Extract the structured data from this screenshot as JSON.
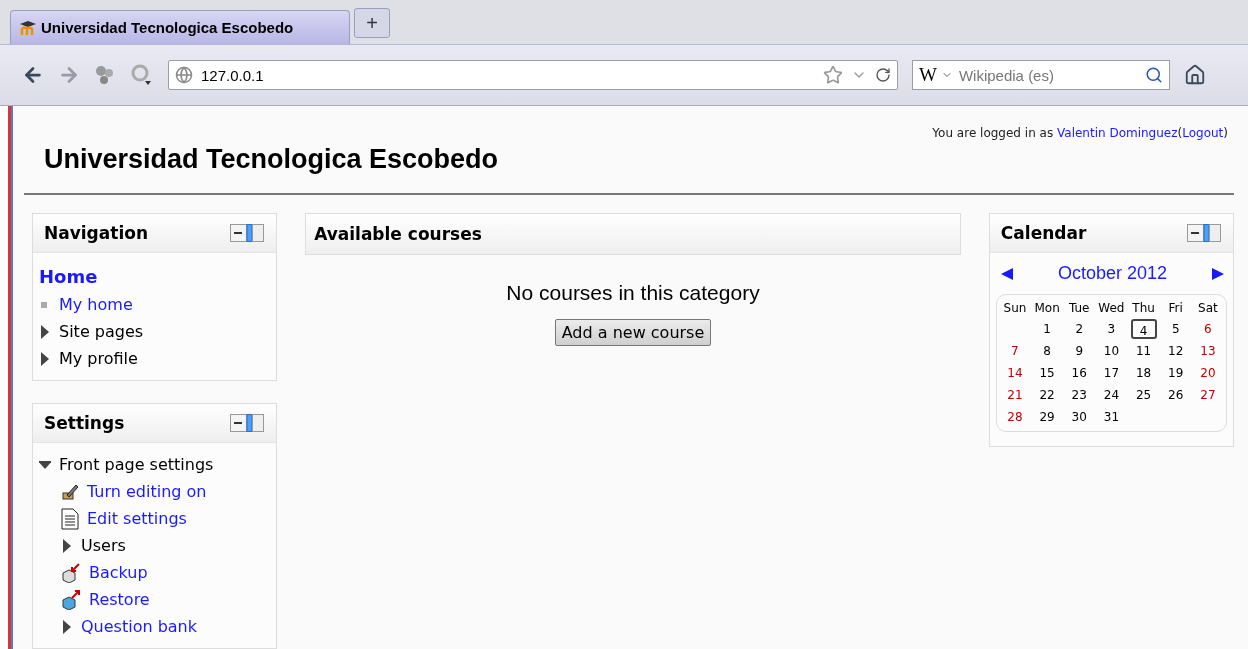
{
  "browser": {
    "tab": {
      "title": "Universidad Tecnologica Escobedo",
      "selected": true
    },
    "new_tab": "+",
    "address": "127.0.0.1",
    "search": {
      "engine": "W",
      "placeholder": "Wikipedia (es)"
    }
  },
  "header": {
    "site_title": "Universidad Tecnologica Escobedo",
    "login_prefix": "You are logged in as",
    "user": "Valentin Dominguez",
    "logout_open": "(",
    "logout": "Logout",
    "logout_close": ")"
  },
  "navigation": {
    "title": "Navigation",
    "home": "Home",
    "items": [
      {
        "label": "My home",
        "kind": "leaf",
        "link": true
      },
      {
        "label": "Site pages",
        "kind": "branch",
        "link": false,
        "expanded": false
      },
      {
        "label": "My profile",
        "kind": "branch",
        "link": false,
        "expanded": false
      }
    ]
  },
  "settings": {
    "title": "Settings",
    "items": [
      {
        "label": "Front page settings",
        "kind": "branch",
        "link": false,
        "expanded": true,
        "children": [
          {
            "label": "Turn editing on",
            "kind": "edit",
            "link": true
          },
          {
            "label": "Edit settings",
            "kind": "document",
            "link": true
          },
          {
            "label": "Users",
            "kind": "branch",
            "link": false,
            "expanded": false
          },
          {
            "label": "Backup",
            "kind": "backup",
            "link": true
          },
          {
            "label": "Restore",
            "kind": "restore",
            "link": true
          },
          {
            "label": "Question bank",
            "kind": "branch",
            "link": true,
            "expanded": false
          }
        ]
      }
    ]
  },
  "main": {
    "title": "Available courses",
    "message": "No courses in this category",
    "button": "Add a new course"
  },
  "calendar": {
    "title": "Calendar",
    "month": "October 2012",
    "weekdays": [
      "Sun",
      "Mon",
      "Tue",
      "Wed",
      "Thu",
      "Fri",
      "Sat"
    ],
    "weeks": [
      [
        {
          "day": "1",
          "weekend": false,
          "today": false
        },
        {
          "day": "2",
          "weekend": false,
          "today": false
        },
        {
          "day": "3",
          "weekend": false,
          "today": false
        },
        {
          "day": "4",
          "weekend": false,
          "today": true
        },
        {
          "day": "5",
          "weekend": false,
          "today": false
        },
        {
          "day": "6",
          "weekend": true,
          "today": false
        }
      ],
      [
        {
          "day": "7",
          "weekend": true,
          "today": false
        },
        {
          "day": "8",
          "weekend": false,
          "today": false
        },
        {
          "day": "9",
          "weekend": false,
          "today": false
        },
        {
          "day": "10",
          "weekend": false,
          "today": false
        },
        {
          "day": "11",
          "weekend": false,
          "today": false
        },
        {
          "day": "12",
          "weekend": false,
          "today": false
        },
        {
          "day": "13",
          "weekend": true,
          "today": false
        }
      ],
      [
        {
          "day": "14",
          "weekend": true,
          "today": false
        },
        {
          "day": "15",
          "weekend": false,
          "today": false
        },
        {
          "day": "16",
          "weekend": false,
          "today": false
        },
        {
          "day": "17",
          "weekend": false,
          "today": false
        },
        {
          "day": "18",
          "weekend": false,
          "today": false
        },
        {
          "day": "19",
          "weekend": false,
          "today": false
        },
        {
          "day": "20",
          "weekend": true,
          "today": false
        }
      ],
      [
        {
          "day": "21",
          "weekend": true,
          "today": false
        },
        {
          "day": "22",
          "weekend": false,
          "today": false
        },
        {
          "day": "23",
          "weekend": false,
          "today": false
        },
        {
          "day": "24",
          "weekend": false,
          "today": false
        },
        {
          "day": "25",
          "weekend": false,
          "today": false
        },
        {
          "day": "26",
          "weekend": false,
          "today": false
        },
        {
          "day": "27",
          "weekend": true,
          "today": false
        }
      ],
      [
        {
          "day": "28",
          "weekend": true,
          "today": false
        },
        {
          "day": "29",
          "weekend": false,
          "today": false
        },
        {
          "day": "30",
          "weekend": false,
          "today": false
        },
        {
          "day": "31",
          "weekend": false,
          "today": false
        }
      ]
    ]
  }
}
